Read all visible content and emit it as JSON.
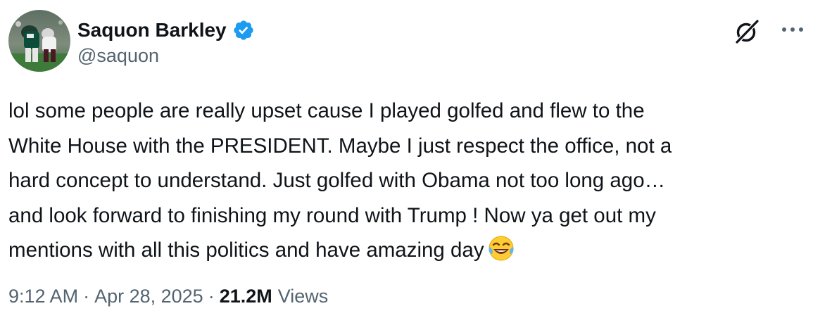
{
  "author": {
    "name": "Saquon Barkley",
    "handle": "@saquon",
    "verified": true,
    "verified_color": "#1d9bf0",
    "avatar_icon": "football-player-avatar"
  },
  "actions": {
    "grok_icon": "grok-icon",
    "more_icon": "more-dots-icon"
  },
  "tweet": {
    "lines": [
      "lol some people are really upset cause I played golfed and flew to the",
      "White House with the PRESIDENT. Maybe I just respect the office, not a",
      "hard concept to understand. Just golfed with Obama not too long ago…",
      "and look forward to finishing my round with Trump ! Now ya get out my",
      "mentions with all this politics and have amazing day"
    ],
    "emoji": "face-with-tears-of-joy-icon"
  },
  "meta": {
    "time": "9:12 AM",
    "separator": "·",
    "date": "Apr 28, 2025",
    "views_count": "21.2M",
    "views_label": "Views"
  },
  "colors": {
    "text": "#0f1419",
    "secondary": "#536471",
    "background": "#ffffff"
  }
}
